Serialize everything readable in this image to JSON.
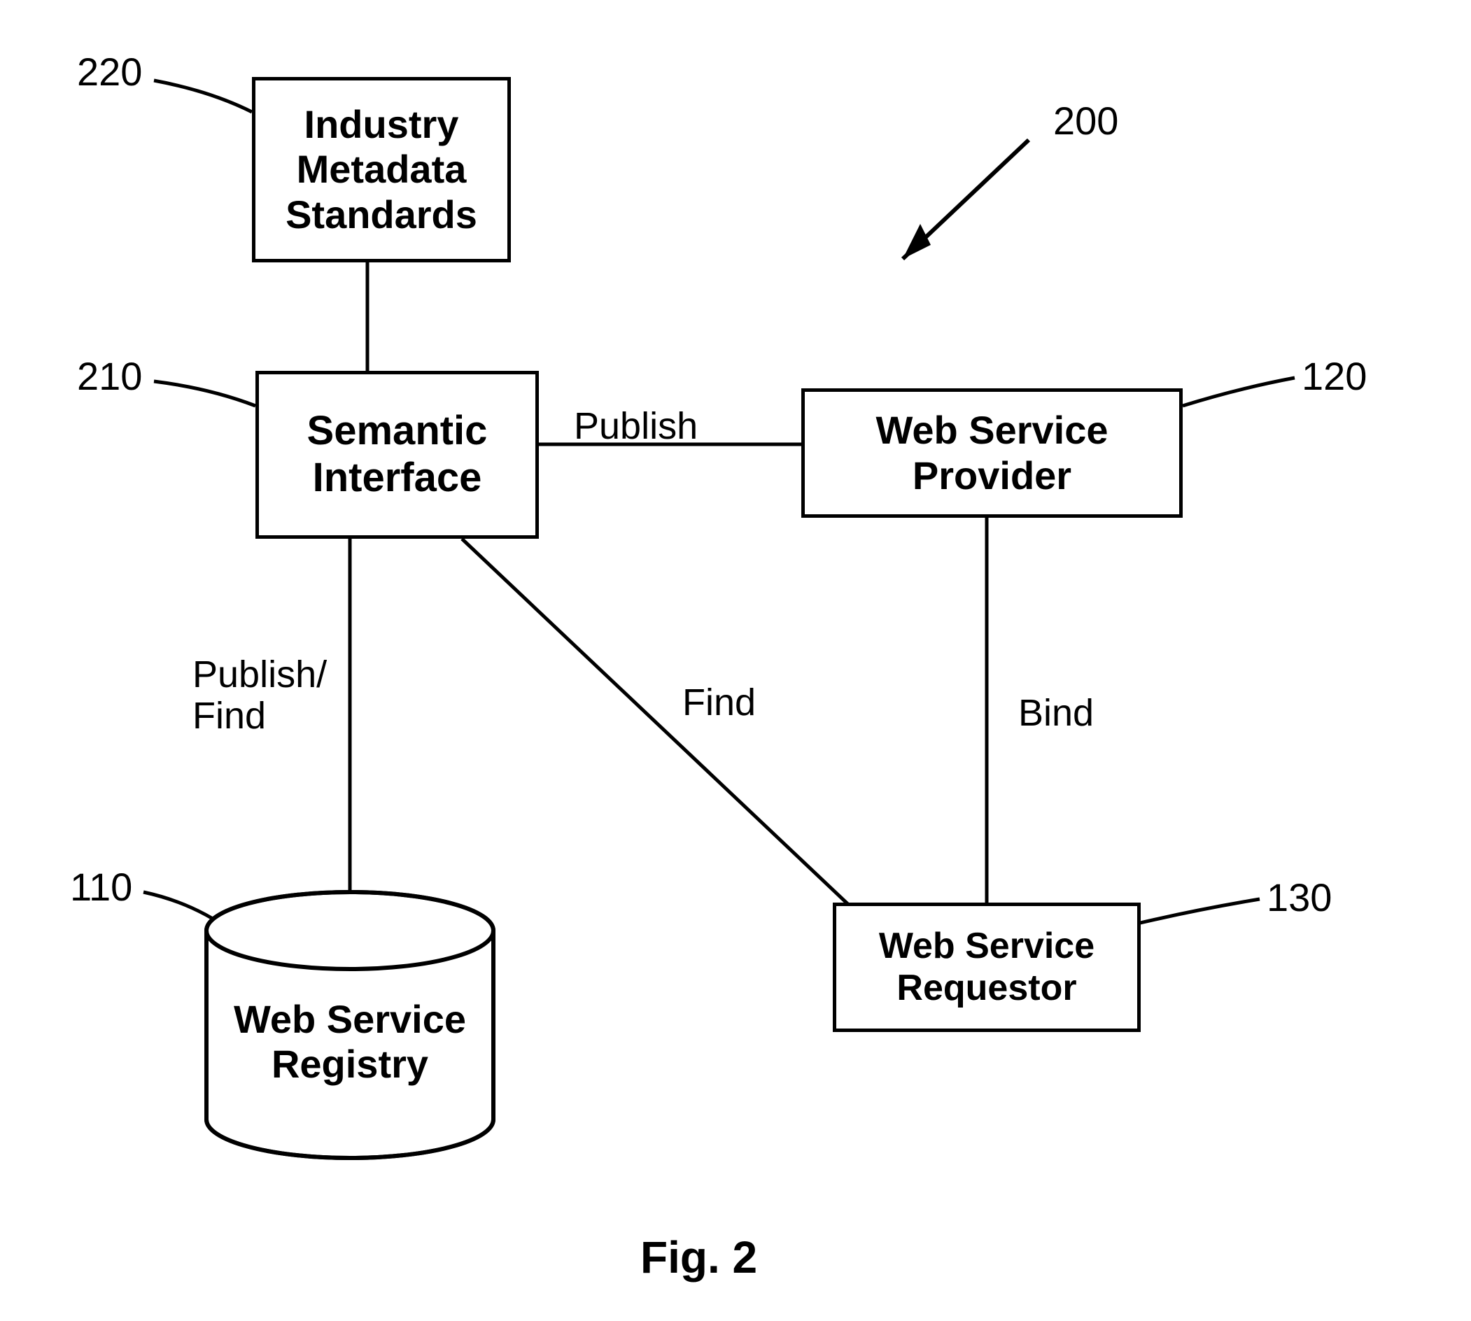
{
  "diagram": {
    "figure_caption": "Fig. 2",
    "nodes": {
      "standards": {
        "label": "Industry\nMetadata\nStandards",
        "ref": "220"
      },
      "semantic": {
        "label": "Semantic\nInterface",
        "ref": "210"
      },
      "provider": {
        "label": "Web Service\nProvider",
        "ref": "120"
      },
      "requestor": {
        "label": "Web Service\nRequestor",
        "ref": "130"
      },
      "registry": {
        "label": "Web Service\nRegistry",
        "ref": "110"
      }
    },
    "edges": {
      "semantic_provider": {
        "label": "Publish"
      },
      "semantic_registry": {
        "label": "Publish/\nFind"
      },
      "semantic_requestor": {
        "label": "Find"
      },
      "provider_requestor": {
        "label": "Bind"
      }
    },
    "pointer": {
      "ref": "200"
    }
  }
}
